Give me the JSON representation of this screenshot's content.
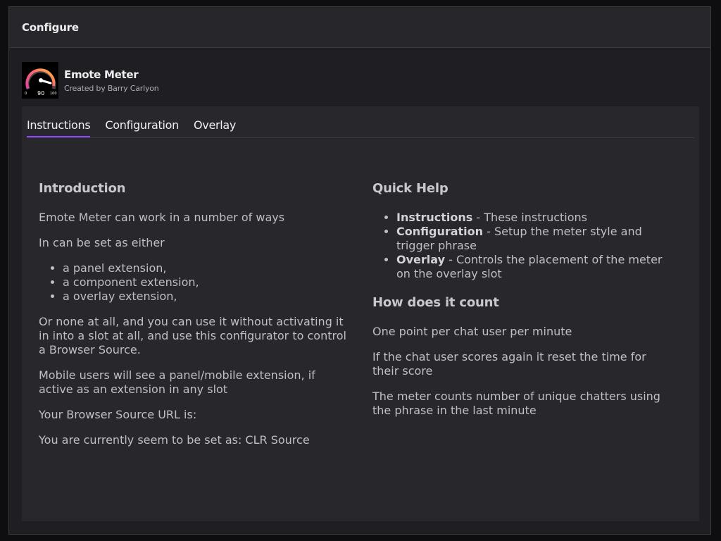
{
  "window": {
    "title": "Configure"
  },
  "extension": {
    "name": "Emote Meter",
    "author": "Created by Barry Carlyon",
    "logo_icon": "speedometer-icon",
    "logo_value": "90"
  },
  "tabs": [
    {
      "label": "Instructions",
      "active": true
    },
    {
      "label": "Configuration",
      "active": false
    },
    {
      "label": "Overlay",
      "active": false
    }
  ],
  "intro": {
    "heading": "Introduction",
    "p1": "Emote Meter can work in a number of ways",
    "p2": "In can be set as either",
    "list": [
      "a panel extension,",
      "a component extension,",
      "a overlay extension,"
    ],
    "p3": "Or none at all, and you can use it without activating it in into a slot at all, and use this configurator to control a Browser Source.",
    "p4": "Mobile users will see a panel/mobile extension, if active as an extension in any slot",
    "p5": "Your Browser Source URL is:",
    "p6": "You are currently seem to be set as: CLR Source"
  },
  "quick_help": {
    "heading": "Quick Help",
    "items": [
      {
        "term": "Instructions",
        "desc": " - These instructions"
      },
      {
        "term": "Configuration",
        "desc": " - Setup the meter style and trigger phrase"
      },
      {
        "term": "Overlay",
        "desc": " - Controls the placement of the meter on the overlay slot"
      }
    ]
  },
  "counting": {
    "heading": "How does it count",
    "p1": "One point per chat user per minute",
    "p2": "If the chat user scores again it reset the time for their score",
    "p3": "The meter counts number of unique chatters using the phrase in the last minute"
  },
  "colors": {
    "accent": "#9147ff",
    "background": "#1f1f23",
    "panel": "#28282c"
  }
}
